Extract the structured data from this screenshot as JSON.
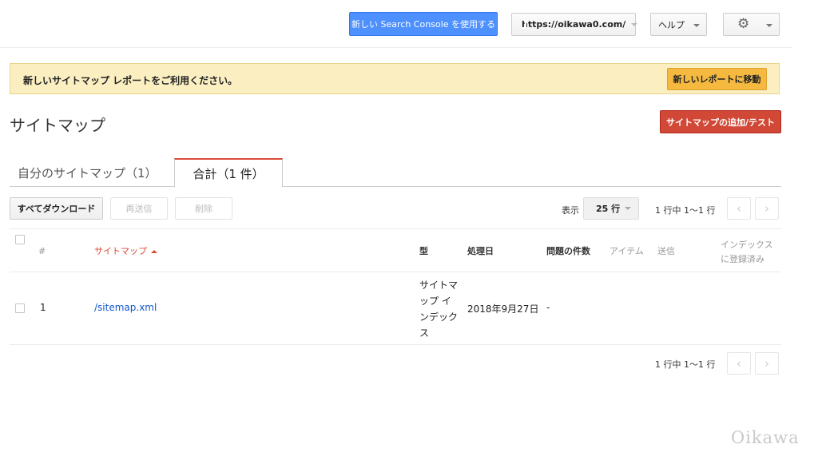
{
  "header": {
    "new_console_button": "新しい Search Console を使用する",
    "property_selector": "https://oikawa0.com/",
    "help_menu": "ヘルプ",
    "settings_icon": "gear-icon"
  },
  "banner": {
    "message": "新しいサイトマップ レポートをご利用ください。",
    "button": "新しいレポートに移動"
  },
  "page": {
    "title": "サイトマップ",
    "add_test_button": "サイトマップの追加/テスト"
  },
  "tabs": [
    {
      "label": "自分のサイトマップ（1）",
      "active": false
    },
    {
      "label": "合計（1 件）",
      "active": true
    }
  ],
  "toolbar": {
    "download_all": "すべてダウンロード",
    "resend": "再送信",
    "delete": "削除",
    "show_label": "表示",
    "rows_per_page": "25 行",
    "pager_text": "1 行中 1〜1 行"
  },
  "table": {
    "columns": {
      "index": "#",
      "sitemap": "サイトマップ",
      "type": "型",
      "processed": "処理日",
      "issues": "問題の件数",
      "items": "アイテム",
      "submitted": "送信",
      "indexed_line1": "インデックス",
      "indexed_line2": "に登録済み"
    },
    "rows": [
      {
        "index": "1",
        "sitemap": "/sitemap.xml",
        "type_lines": [
          "サイトマ",
          "ップ イ",
          "ンデック",
          "ス"
        ],
        "processed": "2018年9月27日",
        "issues": "-"
      }
    ]
  },
  "footer_pager": {
    "pager_text": "1 行中 1〜1 行"
  },
  "watermark": "Oikawa",
  "colors": {
    "primary_blue": "#4d90fe",
    "action_red": "#d14836",
    "banner_bg": "#fbefc2",
    "banner_button": "#f5b940",
    "link": "#1155cc",
    "sorted_header": "#dd4b39"
  }
}
